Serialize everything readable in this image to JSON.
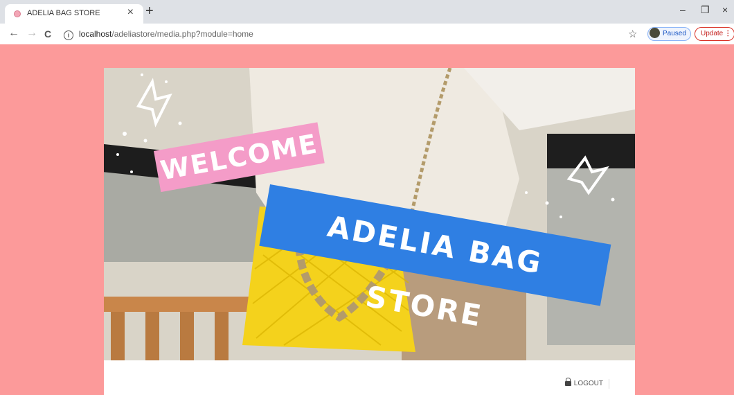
{
  "browser": {
    "tab_title": "ADELIA BAG STORE",
    "tab_close": "×",
    "new_tab": "+",
    "window_controls": {
      "minimize": "–",
      "restore": "❐",
      "close": "×"
    },
    "nav": {
      "back": "←",
      "forward": "→",
      "reload": "C"
    },
    "url_info": "i",
    "url_host": "localhost",
    "url_path": "/adeliastore/media.php?module=home",
    "bookmark_star": "☆",
    "profile_label": "Paused",
    "update_label": "Update",
    "update_menu": "⋮"
  },
  "hero": {
    "welcome_text": "WELCOME",
    "store_text": "ADELIA BAG STORE",
    "colors": {
      "welcome_sign": "#f49cc8",
      "store_sign": "#2f7fe3",
      "bag": "#f4d21c"
    }
  },
  "page": {
    "background": "#fc9a9a",
    "logout_label": "LOGOUT",
    "logout_icon": "lock-icon"
  }
}
